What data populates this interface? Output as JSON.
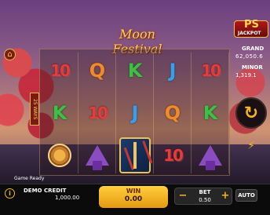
{
  "game": {
    "title": "Moon Festival",
    "paylines_label": "25 WAYS"
  },
  "icons": {
    "home": "home-icon",
    "spin": "spin-arrow-icon",
    "turbo": "lightning-icon",
    "info": "info-icon",
    "wallet": "wallet-icon"
  },
  "reels": [
    [
      "10",
      "K",
      "mooncake"
    ],
    [
      "Q",
      "10",
      "hat"
    ],
    [
      "K",
      "J",
      "arrows"
    ],
    [
      "J",
      "Q",
      "10"
    ],
    [
      "10",
      "K",
      "hat"
    ]
  ],
  "jackpot": {
    "logo": "PS",
    "logo_sub": "JACKPOT",
    "grand_label": "GRAND",
    "grand_value": "62,050.6",
    "minor_label": "MINOR",
    "minor_value": "1,319.1"
  },
  "status": {
    "text": "Game Ready"
  },
  "bottom": {
    "credit_label": "DEMO CREDIT",
    "credit_value": "1,000.00",
    "win_label": "WIN",
    "win_value": "0.00",
    "bet_label": "BET",
    "bet_value": "0.50",
    "bet_minus": "−",
    "bet_plus": "+",
    "auto_label": "AUTO"
  },
  "colors": {
    "accent": "#f5b51e",
    "win_bg": "#ffcf3d",
    "bar_bg": "#0b0b0b"
  }
}
